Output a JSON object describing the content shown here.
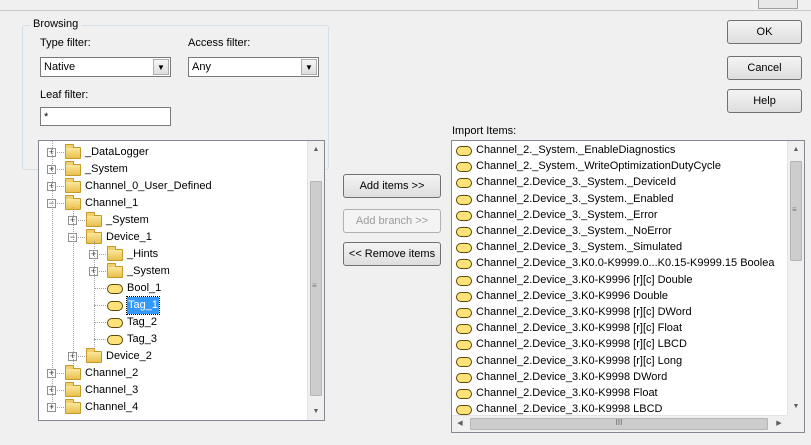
{
  "browsing": {
    "group_title": "Browsing",
    "type_filter": {
      "label": "Type filter:",
      "value": "Native"
    },
    "access_filter": {
      "label": "Access filter:",
      "value": "Any"
    },
    "leaf_filter": {
      "label": "Leaf filter:",
      "value": "*"
    }
  },
  "tree": {
    "items": [
      {
        "label": "_DataLogger",
        "icon": "folder-icon",
        "expander": "+",
        "level": 1
      },
      {
        "label": "_System",
        "icon": "folder-icon",
        "expander": "+",
        "level": 1
      },
      {
        "label": "Channel_0_User_Defined",
        "icon": "folder-icon",
        "expander": "+",
        "level": 1
      },
      {
        "label": "Channel_1",
        "icon": "open-folder-icon",
        "expander": "−",
        "level": 1
      },
      {
        "label": "_System",
        "icon": "folder-icon",
        "expander": "+",
        "level": 2
      },
      {
        "label": "Device_1",
        "icon": "open-folder-icon",
        "expander": "−",
        "level": 2
      },
      {
        "label": "_Hints",
        "icon": "folder-icon",
        "expander": "+",
        "level": 3
      },
      {
        "label": "_System",
        "icon": "folder-icon",
        "expander": "+",
        "level": 3
      },
      {
        "label": "Bool_1",
        "icon": "tag-icon",
        "expander": "",
        "level": 3
      },
      {
        "label": "Tag_1",
        "icon": "tag-icon",
        "expander": "",
        "level": 3,
        "selected": true
      },
      {
        "label": "Tag_2",
        "icon": "tag-icon",
        "expander": "",
        "level": 3
      },
      {
        "label": "Tag_3",
        "icon": "tag-icon",
        "expander": "",
        "level": 3
      },
      {
        "label": "Device_2",
        "icon": "folder-icon",
        "expander": "+",
        "level": 2
      },
      {
        "label": "Channel_2",
        "icon": "folder-icon",
        "expander": "+",
        "level": 1
      },
      {
        "label": "Channel_3",
        "icon": "folder-icon",
        "expander": "+",
        "level": 1
      },
      {
        "label": "Channel_4",
        "icon": "folder-icon",
        "expander": "+",
        "level": 1
      }
    ]
  },
  "buttons": {
    "add_items": "Add items >>",
    "add_branch": "Add branch >>",
    "remove_items": "<< Remove items",
    "ok": "OK",
    "cancel": "Cancel",
    "help": "Help"
  },
  "import": {
    "label": "Import Items:",
    "items": [
      "Channel_2._System._EnableDiagnostics",
      "Channel_2._System._WriteOptimizationDutyCycle",
      "Channel_2.Device_3._System._DeviceId",
      "Channel_2.Device_3._System._Enabled",
      "Channel_2.Device_3._System._Error",
      "Channel_2.Device_3._System._NoError",
      "Channel_2.Device_3._System._Simulated",
      "Channel_2.Device_3.K0.0-K9999.0...K0.15-K9999.15 Boolea",
      "Channel_2.Device_3.K0-K9996 [r][c] Double",
      "Channel_2.Device_3.K0-K9996 Double",
      "Channel_2.Device_3.K0-K9998 [r][c] DWord",
      "Channel_2.Device_3.K0-K9998 [r][c] Float",
      "Channel_2.Device_3.K0-K9998 [r][c] LBCD",
      "Channel_2.Device_3.K0-K9998 [r][c] Long",
      "Channel_2.Device_3.K0-K9998 DWord",
      "Channel_2.Device_3.K0-K9998 Float",
      "Channel_2.Device_3.K0-K9998 LBCD"
    ],
    "hscroll_grip": "III"
  },
  "scroll_glyphs": {
    "up": "▲",
    "down": "▼",
    "left": "◀",
    "right": "▶",
    "grip": "≡"
  }
}
